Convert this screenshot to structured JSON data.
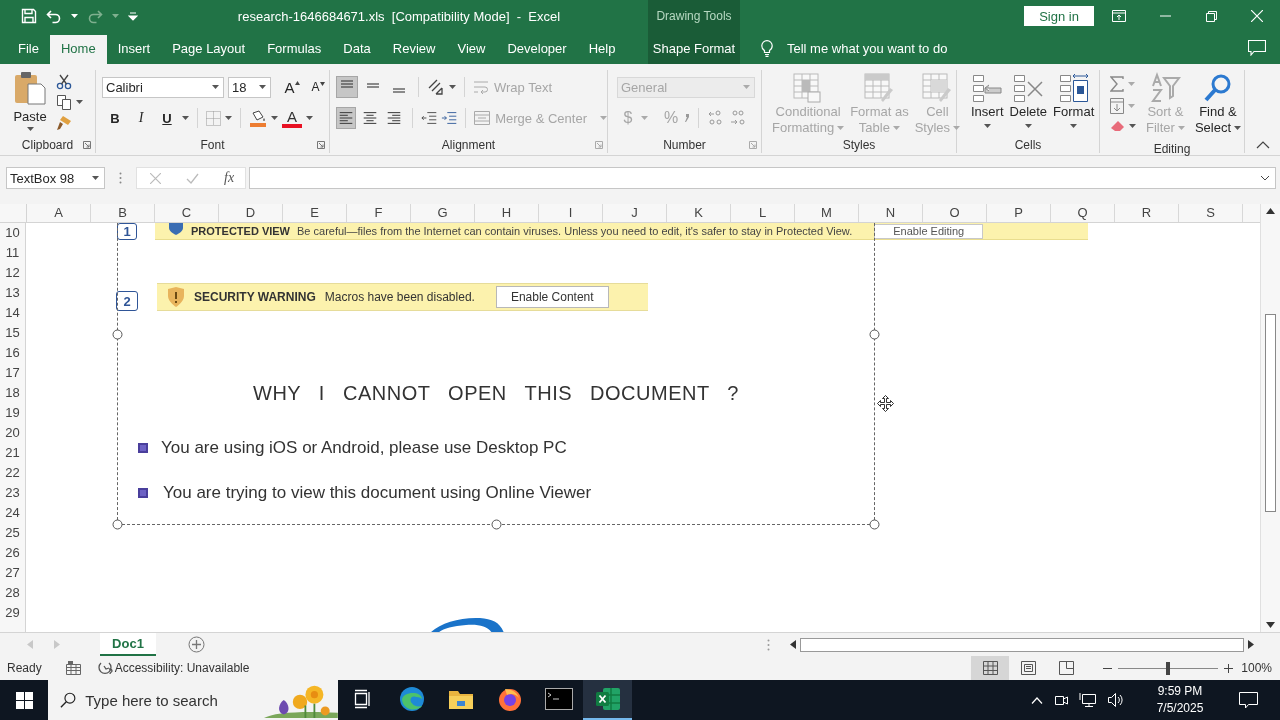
{
  "title_bar": {
    "title": "research-1646684671.xls  [Compatibility Mode]  -  Excel",
    "context_label": "Drawing Tools",
    "sign_in": "Sign in"
  },
  "tabs": [
    {
      "label": "File",
      "selected": false,
      "kind": "normal"
    },
    {
      "label": "Home",
      "selected": true,
      "kind": "normal"
    },
    {
      "label": "Insert",
      "selected": false,
      "kind": "normal"
    },
    {
      "label": "Page Layout",
      "selected": false,
      "kind": "normal"
    },
    {
      "label": "Formulas",
      "selected": false,
      "kind": "normal"
    },
    {
      "label": "Data",
      "selected": false,
      "kind": "normal"
    },
    {
      "label": "Review",
      "selected": false,
      "kind": "normal"
    },
    {
      "label": "View",
      "selected": false,
      "kind": "normal"
    },
    {
      "label": "Developer",
      "selected": false,
      "kind": "normal"
    },
    {
      "label": "Help",
      "selected": false,
      "kind": "normal"
    },
    {
      "label": "Shape Format",
      "selected": false,
      "kind": "contextual"
    }
  ],
  "tell_me": "Tell me what you want to do",
  "ribbon": {
    "clipboard": {
      "label": "Clipboard",
      "paste": "Paste"
    },
    "font": {
      "label": "Font",
      "name": "Calibri",
      "size": "18",
      "grow": "A",
      "shrink": "A",
      "bold": "B",
      "italic": "I",
      "underline": "U",
      "font_color": "A"
    },
    "alignment": {
      "label": "Alignment",
      "buttons": [
        {
          "kind": "top",
          "selected": true
        },
        {
          "kind": "middle",
          "selected": false
        },
        {
          "kind": "bottom",
          "selected": false
        },
        {
          "kind": "left",
          "selected": true
        },
        {
          "kind": "center",
          "selected": false
        },
        {
          "kind": "right",
          "selected": false
        }
      ],
      "wrap_text": {
        "label": "Wrap Text",
        "disabled": true
      },
      "merge": {
        "label": "Merge & Center",
        "disabled": true
      }
    },
    "number": {
      "label": "Number",
      "format": "General",
      "currency": "$",
      "percent": "%",
      "disabled": true
    },
    "styles": {
      "label": "Styles",
      "buttons": [
        {
          "kind": "conditional",
          "lines": [
            "Conditional",
            "Formatting"
          ],
          "disabled": true
        },
        {
          "kind": "table",
          "lines": [
            "Format as",
            "Table"
          ],
          "disabled": true
        },
        {
          "kind": "cell",
          "lines": [
            "Cell",
            "Styles"
          ],
          "disabled": true
        }
      ]
    },
    "cells": {
      "label": "Cells",
      "buttons": [
        {
          "kind": "insert",
          "label": "Insert",
          "disabled": false
        },
        {
          "kind": "delete",
          "label": "Delete",
          "disabled": false
        },
        {
          "kind": "format",
          "label": "Format",
          "disabled": false
        }
      ]
    },
    "editing": {
      "label": "Editing",
      "buttons": [
        {
          "kind": "sort",
          "lines": [
            "Sort &",
            "Filter"
          ],
          "disabled": true
        },
        {
          "kind": "find",
          "lines": [
            "Find &",
            "Select"
          ],
          "disabled": false
        }
      ]
    }
  },
  "formula_bar": {
    "name_box": "TextBox 98",
    "fx": "fx"
  },
  "columns": [
    "A",
    "B",
    "C",
    "D",
    "E",
    "F",
    "G",
    "H",
    "I",
    "J",
    "K",
    "L",
    "M",
    "N",
    "O",
    "P",
    "Q",
    "R",
    "S"
  ],
  "rows": [
    "10",
    "11",
    "12",
    "13",
    "14",
    "15",
    "16",
    "17",
    "18",
    "19",
    "20",
    "21",
    "22",
    "23",
    "24",
    "25",
    "26",
    "27",
    "28",
    "29"
  ],
  "document": {
    "protected_view": {
      "step": "1",
      "title": "PROTECTED VIEW",
      "message": "Be careful—files from the Internet can contain viruses. Unless you need to edit, it's safer to stay in Protected View.",
      "button": "Enable Editing"
    },
    "security_warning": {
      "step": "2",
      "title": "SECURITY WARNING",
      "message": "Macros have been disabled.",
      "button": "Enable Content"
    },
    "heading": "WHY I CANNOT OPEN THIS DOCUMENT ?",
    "bullets": [
      "You are using iOS or Android, please use Desktop PC",
      "You are trying to view this document using Online Viewer"
    ]
  },
  "sheet_tabs": [
    {
      "label": "Doc1",
      "selected": true
    }
  ],
  "status_bar": {
    "status": "Ready",
    "accessibility": "Accessibility: Unavailable",
    "views": [
      {
        "kind": "normal",
        "selected": true
      },
      {
        "kind": "page-layout",
        "selected": false
      },
      {
        "kind": "page-break",
        "selected": false
      }
    ],
    "zoom": {
      "level": 0.5,
      "reading": "100%"
    }
  },
  "taskbar": {
    "search_placeholder": "Type here to search",
    "apps": [
      {
        "kind": "task-view",
        "selected": false
      },
      {
        "kind": "edge",
        "selected": false
      },
      {
        "kind": "explorer",
        "selected": false
      },
      {
        "kind": "firefox",
        "selected": false
      },
      {
        "kind": "terminal",
        "selected": false
      },
      {
        "kind": "excel",
        "selected": true
      }
    ],
    "time": "9:59 PM",
    "date": "7/5/2025"
  }
}
